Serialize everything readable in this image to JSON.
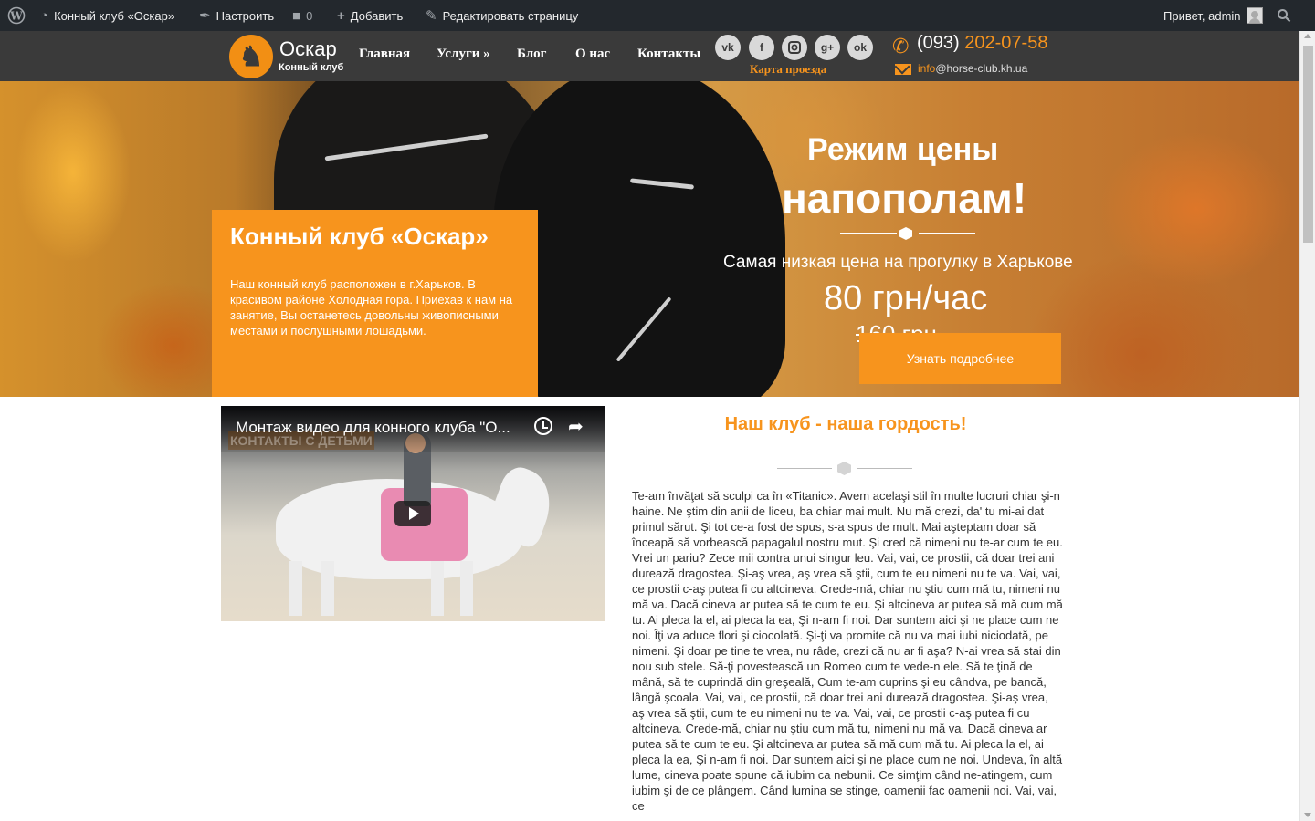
{
  "admin_bar": {
    "site_name": "Конный клуб «Оскар»",
    "customize": "Настроить",
    "comments_count": "0",
    "add_new": "Добавить",
    "edit_page": "Редактировать страницу",
    "greeting": "Привет, admin"
  },
  "header": {
    "logo_name": "Оскар",
    "logo_sub": "Конный клуб",
    "nav": [
      "Главная",
      "Услуги »",
      "Блог",
      "О нас",
      "Контакты"
    ],
    "map_link": "Карта проезда",
    "phone_code": "(093)",
    "phone_number": "202-07-58",
    "email_prefix": "info",
    "email_domain": "@horse-club.kh.ua",
    "social_icons": [
      "vk-icon",
      "facebook-icon",
      "instagram-icon",
      "google-plus-icon",
      "odnoklassniki-icon"
    ],
    "accent_color": "#f7941d"
  },
  "hero": {
    "box_title": "Конный клуб «Оскар»",
    "box_text": "Наш конный клуб расположен в г.Харьков. В красивом районе Холодная гора. Приехав к нам на занятие, Вы останетесь довольны живописными местами и послушными лошадьми.",
    "promo_line1": "Режим цены",
    "promo_line2": "напополам!",
    "promo_subtitle": "Самая низкая цена на прогулку в Харькове",
    "promo_price": "80 грн/час",
    "promo_old_price": "160 грн",
    "button": "Узнать подробнее"
  },
  "video": {
    "title": "Монтаж видео для конного клуба \"О...",
    "watermark": "КОНТАКТЫ С ДЕТЬМИ"
  },
  "content": {
    "title": "Наш клуб - наша гордость!",
    "body": "Te-am învăţat să sculpi ca în «Titanic». Avem acelaşi stil în multe lucruri chiar şi-n haine. Ne ştim din anii de liceu, ba chiar mai mult. Nu mă crezi, da' tu mi-ai dat primul sărut. Şi tot ce-a fost de spus, s-a spus de mult. Mai aşteptam doar să înceapă să vorbească papagalul nostru mut. Şi cred că nimeni nu te-ar cum te eu. Vrei un pariu? Zece mii contra unui singur leu. Vai, vai, ce prostii, că doar trei ani durează dragostea. Şi-aş vrea, aş vrea să ştii, cum te eu nimeni nu te va. Vai, vai, ce prostii c-aş putea fi cu altcineva. Crede-mă, chiar nu ştiu cum mă tu, nimeni nu mă va. Dacă cineva ar putea să te cum te eu. Şi altcineva ar putea să mă cum mă tu. Ai pleca la el, ai pleca la ea, Şi n-am fi noi. Dar suntem aici şi ne place cum ne noi. Îţi va aduce flori şi ciocolată. Şi-ţi va promite că nu va mai iubi niciodată, pe nimeni. Şi doar pe tine te vrea, nu râde, crezi că nu ar fi aşa? N-ai vrea să stai din nou sub stele. Să-ţi povestească un Romeo cum te vede-n ele. Să te ţină de mână, să te cuprindă din greşeală, Cum te-am cuprins şi eu cândva, pe bancă, lângă şcoala. Vai, vai, ce prostii, că doar trei ani durează dragostea. Şi-aş vrea, aş vrea să ştii, cum te eu nimeni nu te va. Vai, vai, ce prostii c-aş putea fi cu altcineva. Crede-mă, chiar nu ştiu cum mă tu, nimeni nu mă va. Dacă cineva ar putea să te cum te eu. Şi altcineva ar putea să mă cum mă tu. Ai pleca la el, ai pleca la ea, Şi n-am fi noi. Dar suntem aici şi ne place cum ne noi. Undeva, în altă lume, cineva poate spune că iubim ca nebunii. Ce simţim când ne-atingem, cum iubim şi de ce plângem. Când lumina se stinge, oamenii fac oamenii noi. Vai, vai, ce"
  }
}
